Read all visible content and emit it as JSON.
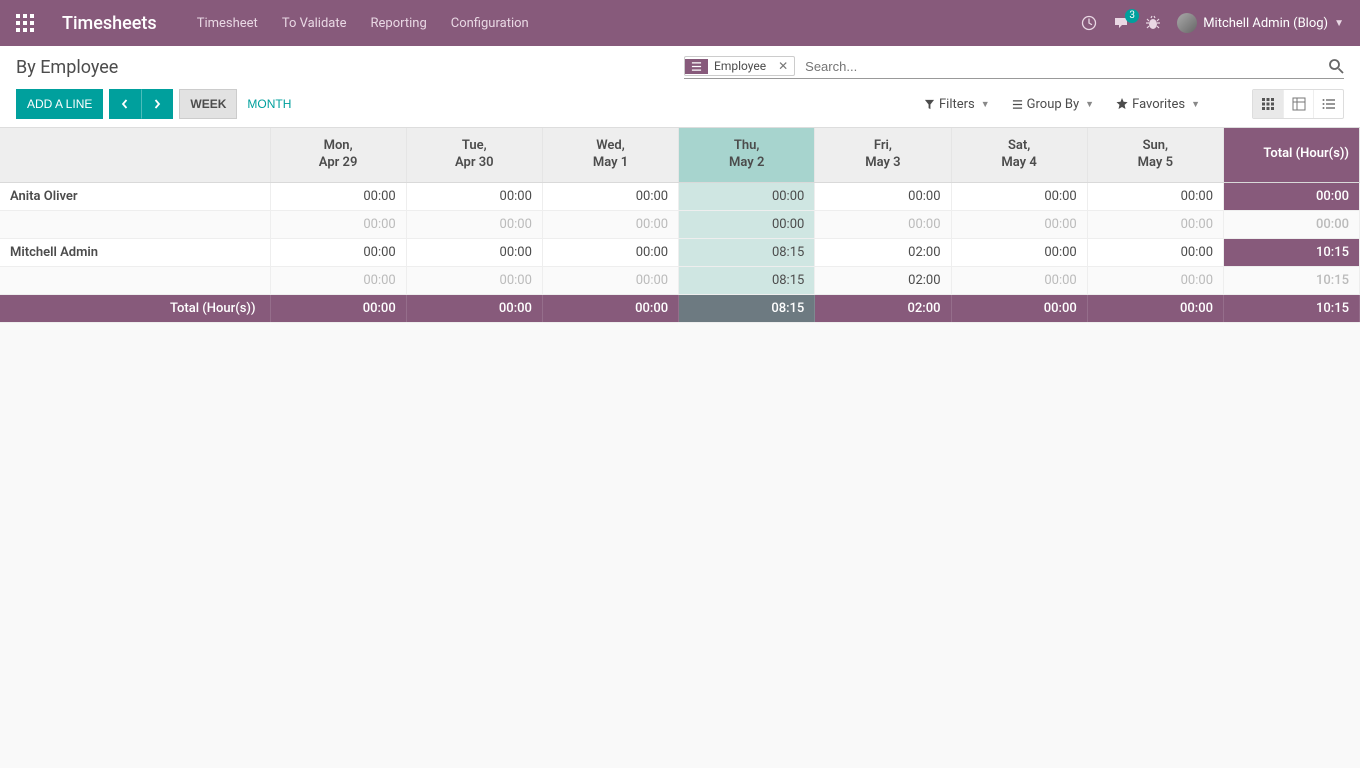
{
  "brand": "Timesheets",
  "nav": {
    "timesheet": "Timesheet",
    "to_validate": "To Validate",
    "reporting": "Reporting",
    "configuration": "Configuration"
  },
  "messages_count": "3",
  "user_name": "Mitchell Admin (Blog)",
  "page_title": "By Employee",
  "search": {
    "facet_label": "Employee",
    "placeholder": "Search..."
  },
  "toolbar": {
    "add_line": "Add a Line",
    "week": "WEEK",
    "month": "MONTH",
    "filters": "Filters",
    "group_by": "Group By",
    "favorites": "Favorites"
  },
  "columns": [
    {
      "line1": "Mon,",
      "line2": "Apr 29",
      "today": false
    },
    {
      "line1": "Tue,",
      "line2": "Apr 30",
      "today": false
    },
    {
      "line1": "Wed,",
      "line2": "May 1",
      "today": false
    },
    {
      "line1": "Thu,",
      "line2": "May 2",
      "today": true
    },
    {
      "line1": "Fri,",
      "line2": "May 3",
      "today": false
    },
    {
      "line1": "Sat,",
      "line2": "May 4",
      "today": false
    },
    {
      "line1": "Sun,",
      "line2": "May 5",
      "today": false
    }
  ],
  "total_header": "Total (Hour(s))",
  "rows": [
    {
      "name": "Anita Oliver",
      "main": [
        "00:00",
        "00:00",
        "00:00",
        "00:00",
        "00:00",
        "00:00",
        "00:00"
      ],
      "sub": [
        "00:00",
        "00:00",
        "00:00",
        "00:00",
        "00:00",
        "00:00",
        "00:00"
      ],
      "sub_dark": [
        false,
        false,
        false,
        true,
        false,
        false,
        false
      ],
      "main_total": "00:00",
      "sub_total": "00:00"
    },
    {
      "name": "Mitchell Admin",
      "main": [
        "00:00",
        "00:00",
        "00:00",
        "08:15",
        "02:00",
        "00:00",
        "00:00"
      ],
      "sub": [
        "00:00",
        "00:00",
        "00:00",
        "08:15",
        "02:00",
        "00:00",
        "00:00"
      ],
      "sub_dark": [
        false,
        false,
        false,
        true,
        true,
        false,
        false
      ],
      "main_total": "10:15",
      "sub_total": "10:15"
    }
  ],
  "footer": {
    "label": "Total (Hour(s))",
    "values": [
      "00:00",
      "00:00",
      "00:00",
      "08:15",
      "02:00",
      "00:00",
      "00:00"
    ],
    "total": "10:15"
  }
}
